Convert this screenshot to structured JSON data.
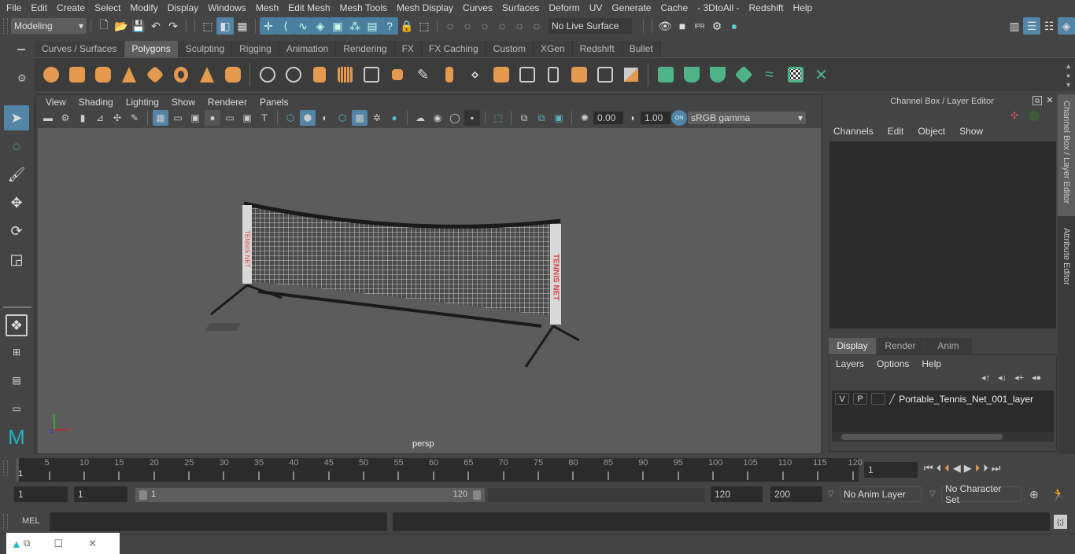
{
  "menubar": [
    "File",
    "Edit",
    "Create",
    "Select",
    "Modify",
    "Display",
    "Windows",
    "Mesh",
    "Edit Mesh",
    "Mesh Tools",
    "Mesh Display",
    "Curves",
    "Surfaces",
    "Deform",
    "UV",
    "Generate",
    "Cache",
    "- 3DtoAll -",
    "Redshift",
    "Help"
  ],
  "statusline": {
    "mode": "Modeling",
    "live_surface": "No Live Surface"
  },
  "shelf": {
    "tabs": [
      "Curves / Surfaces",
      "Polygons",
      "Sculpting",
      "Rigging",
      "Animation",
      "Rendering",
      "FX",
      "FX Caching",
      "Custom",
      "XGen",
      "Redshift",
      "Bullet"
    ],
    "active_tab": "Polygons"
  },
  "viewport": {
    "menu": [
      "View",
      "Shading",
      "Lighting",
      "Show",
      "Renderer",
      "Panels"
    ],
    "exposure": "0.00",
    "gamma": "1.00",
    "color_toggle": "ON",
    "color_space": "sRGB gamma",
    "camera_label": "persp",
    "axis": {
      "x": "x",
      "y": "y",
      "z": "z"
    },
    "model_label": "TENNIS NET"
  },
  "channel_box": {
    "title": "Channel Box / Layer Editor",
    "menu": [
      "Channels",
      "Edit",
      "Object",
      "Show"
    ]
  },
  "layer_editor": {
    "tabs": [
      "Display",
      "Render",
      "Anim"
    ],
    "active_tab": "Display",
    "menu": [
      "Layers",
      "Options",
      "Help"
    ],
    "layers": [
      {
        "v": "V",
        "p": "P",
        "name": "Portable_Tennis_Net_001_layer"
      }
    ]
  },
  "side_tabs": [
    "Channel Box / Layer Editor",
    "Attribute Editor"
  ],
  "timeline": {
    "ticks": [
      5,
      10,
      15,
      20,
      25,
      30,
      35,
      40,
      45,
      50,
      55,
      60,
      65,
      70,
      75,
      80,
      85,
      90,
      95,
      100,
      105,
      110,
      115,
      120
    ],
    "current_frame_marker": "1",
    "current_frame": "1",
    "min": 1,
    "max": 120
  },
  "range": {
    "start": "1",
    "playback_start": "1",
    "slider_start": "1",
    "slider_end": "120",
    "playback_end": "120",
    "end": "200",
    "anim_layer": "No Anim Layer",
    "character_set": "No Character Set"
  },
  "cmdline": {
    "label": "MEL"
  }
}
